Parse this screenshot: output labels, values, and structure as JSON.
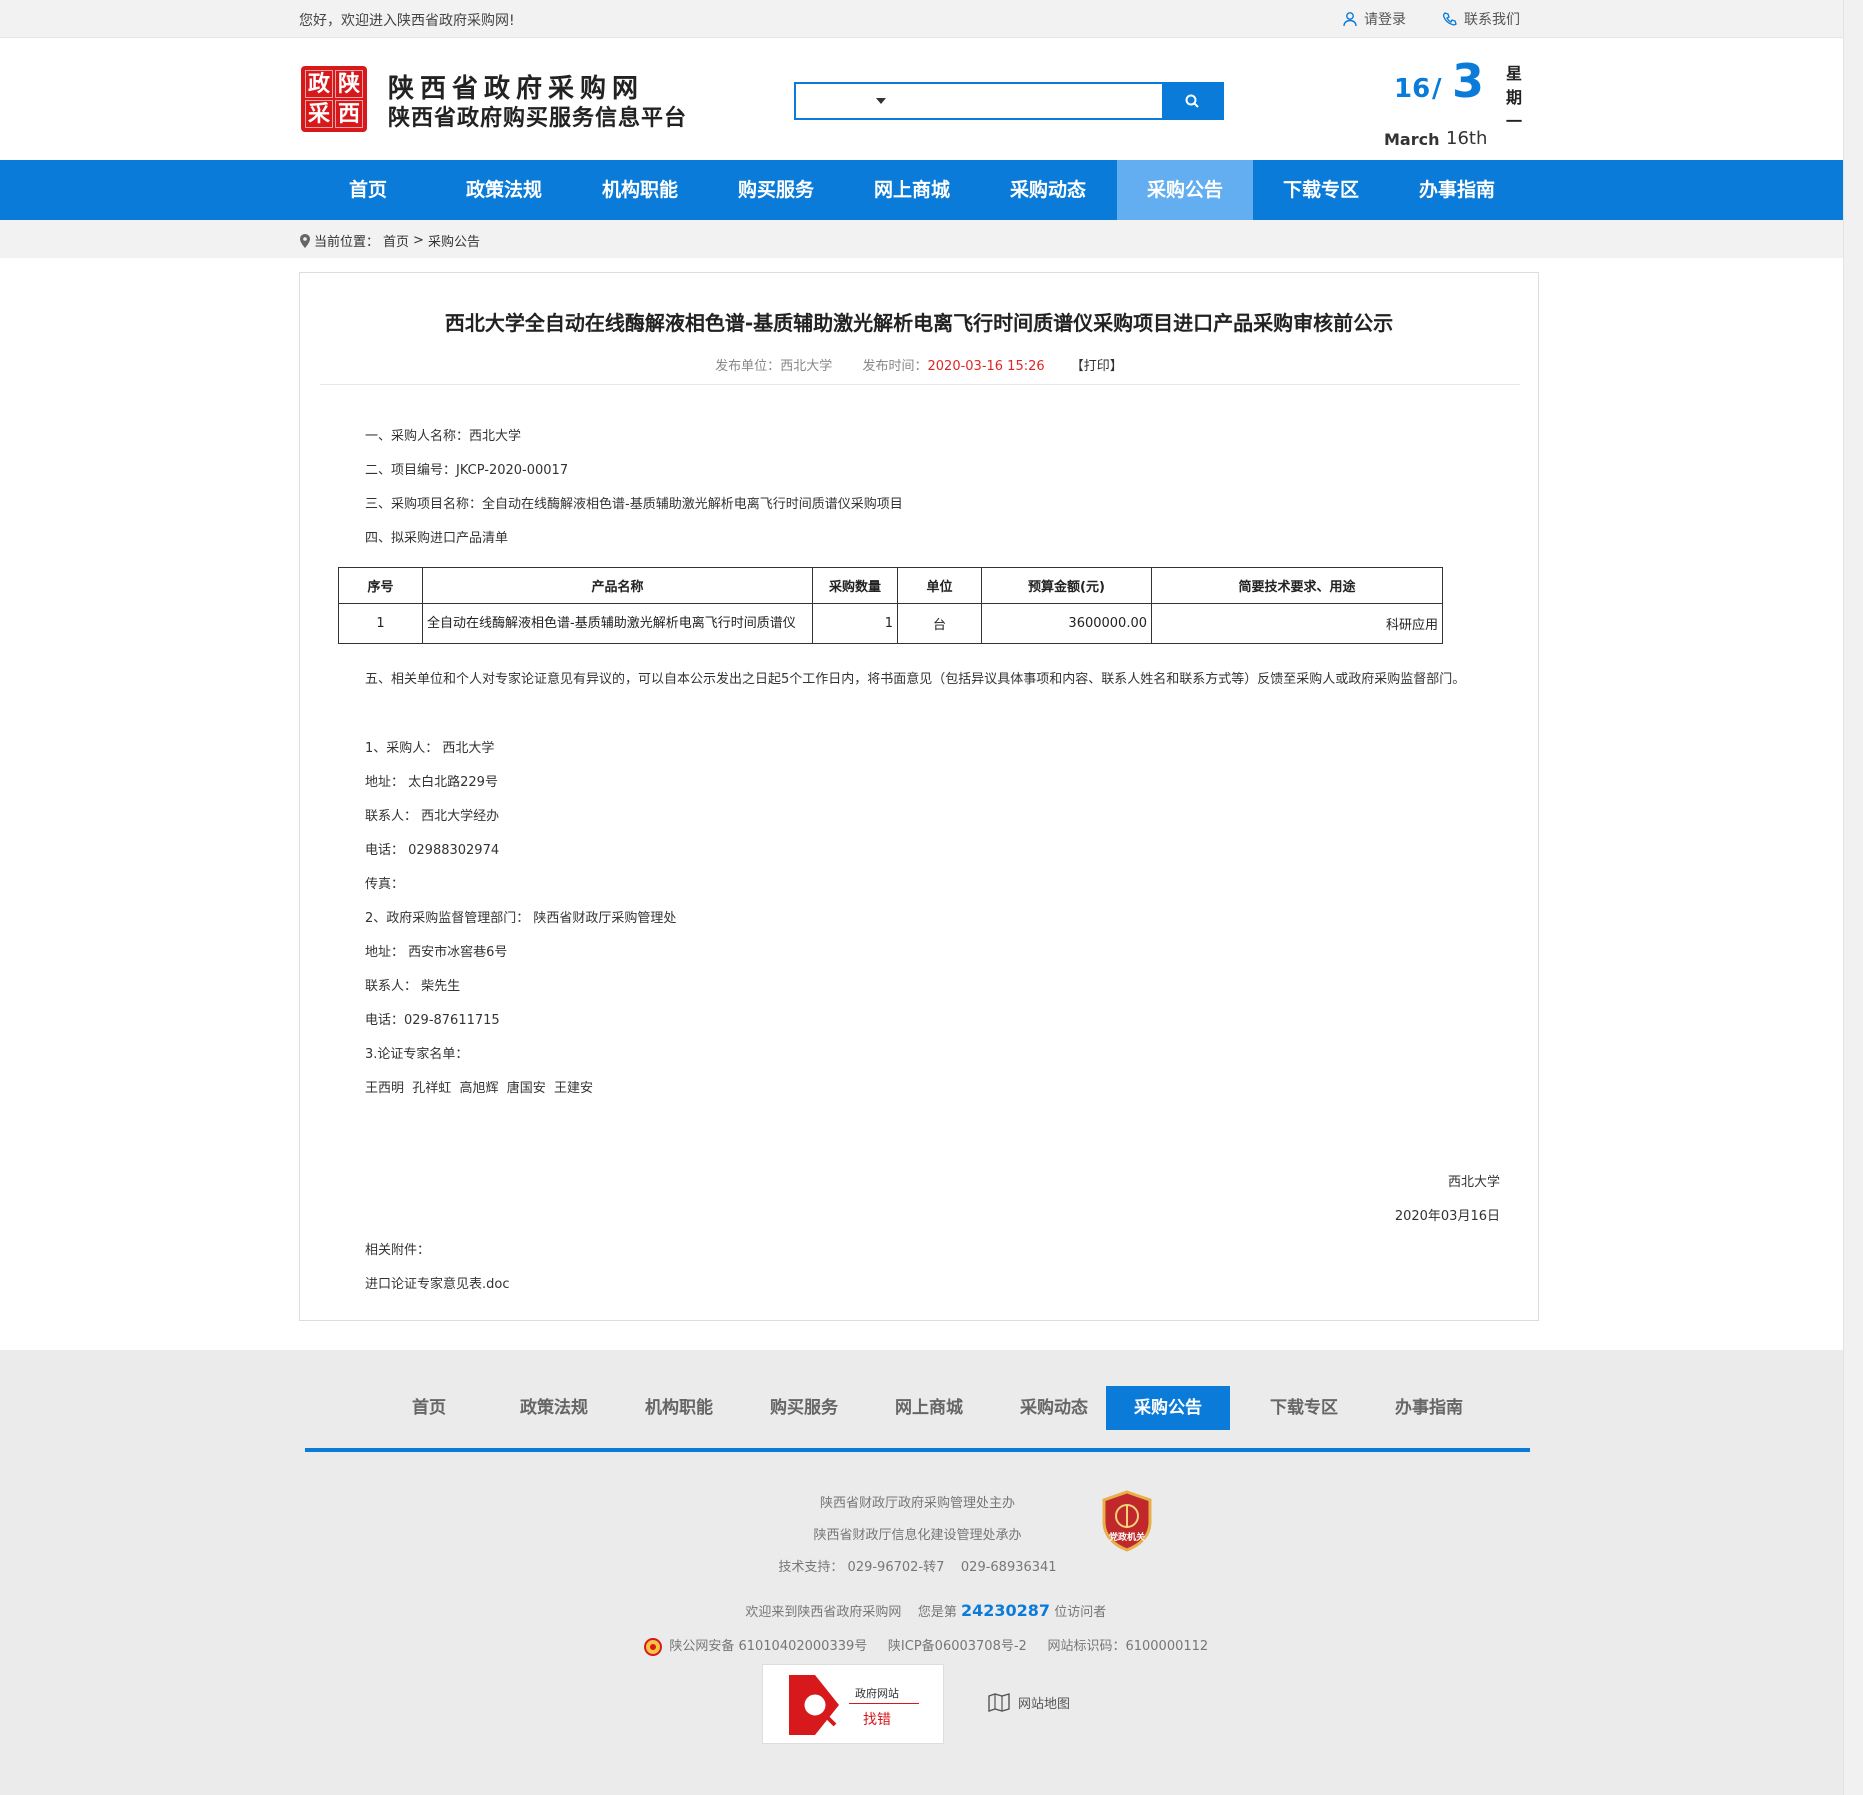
{
  "topbar": {
    "welcome": "您好，欢迎进入陕西省政府采购网!",
    "login": "请登录",
    "contact": "联系我们"
  },
  "header": {
    "logo_chars": [
      "政",
      "陕",
      "采",
      "西"
    ],
    "title_line1": "陕西省政府采购网",
    "title_line2": "陕西省政府购买服务信息平台",
    "search_placeholder": "",
    "date": {
      "day": "16",
      "slash": "/",
      "month_num": "3",
      "month_name": "March",
      "day_name": "16th",
      "weekday": [
        "星",
        "期",
        "一"
      ]
    }
  },
  "nav": {
    "items": [
      "首页",
      "政策法规",
      "机构职能",
      "购买服务",
      "网上商城",
      "采购动态",
      "采购公告",
      "下载专区",
      "办事指南"
    ],
    "active_index": 6
  },
  "breadcrumb": {
    "label": "当前位置：",
    "home": "首页",
    "sep": ">",
    "current": "采购公告"
  },
  "article": {
    "title": "西北大学全自动在线酶解液相色谱-基质辅助激光解析电离飞行时间质谱仪采购项目进口产品采购审核前公示",
    "publisher_label": "发布单位：",
    "publisher": "西北大学",
    "time_label": "发布时间：",
    "time": "2020-03-16 15:26",
    "print": "【打印】",
    "p1": "一、采购人名称：西北大学",
    "p2": "二、项目编号：JKCP-2020-00017",
    "p3": "三、采购项目名称：全自动在线酶解液相色谱-基质辅助激光解析电离飞行时间质谱仪采购项目",
    "p4": "四、拟采购进口产品清单",
    "table": {
      "headers": [
        "序号",
        "产品名称",
        "采购数量",
        "单位",
        "预算金额(元)",
        "简要技术要求、用途"
      ],
      "rows": [
        [
          "1",
          "全自动在线酶解液相色谱-基质辅助激光解析电离飞行时间质谱仪",
          "1",
          "台",
          "3600000.00",
          "科研应用"
        ]
      ]
    },
    "p5": "五、相关单位和个人对专家论证意见有异议的，可以自本公示发出之日起5个工作日内，将书面意见（包括异议具体事项和内容、联系人姓名和联系方式等）反馈至采购人或政府采购监督部门。",
    "c1": "1、采购人： 西北大学",
    "c2": "地址： 太白北路229号",
    "c3": "联系人： 西北大学经办",
    "c4": "电话： 02988302974",
    "c5": "传真：",
    "c6": "2、政府采购监督管理部门： 陕西省财政厅采购管理处",
    "c7": "地址： 西安市冰窖巷6号",
    "c8": "联系人： 柴先生",
    "c9": "电话：029-87611715",
    "c10": "3.论证专家名单：",
    "c11": "王西明  孔祥虹  高旭辉  唐国安  王建安",
    "sign_org": "西北大学",
    "sign_date": "2020年03月16日",
    "attach_label": "相关附件：",
    "attach_file": "进口论证专家意见表.doc"
  },
  "footer": {
    "nav_items": [
      "首页",
      "政策法规",
      "机构职能",
      "购买服务",
      "网上商城",
      "采购动态",
      "采购公告",
      "下载专区",
      "办事指南"
    ],
    "active_index": 6,
    "line1": "陕西省财政厅政府采购管理处主办",
    "line2": "陕西省财政厅信息化建设管理处承办",
    "line3": "技术支持： 029-96702-转7    029-68936341",
    "visit_prefix": "欢迎来到陕西省政府采购网    您是第 ",
    "visit_count": "24230287",
    "visit_suffix": " 位访问者",
    "beian": "陕公网安备 61010402000339号     陕ICP备06003708号-2     网站标识码：6100000112",
    "badge_text": "党政机关",
    "zhaocuo_t1": "政府网站",
    "zhaocuo_t2": "找错",
    "sitemap": "网站地图"
  },
  "colors": {
    "brand_blue": "#0a7bd8",
    "nav_active": "#63aef0",
    "red": "#d7191c",
    "time_red": "#e12525"
  }
}
